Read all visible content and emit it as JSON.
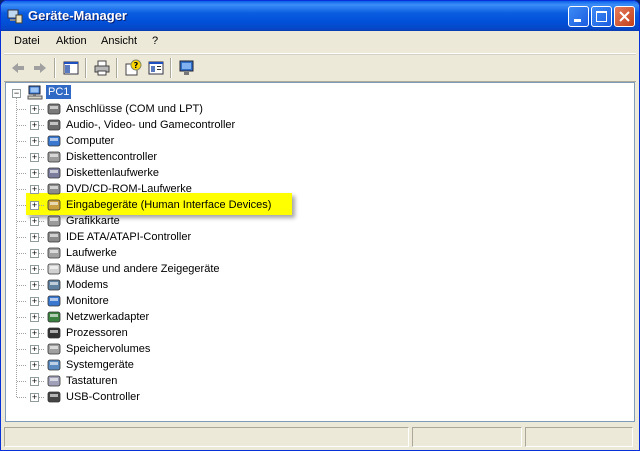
{
  "window": {
    "title": "Geräte-Manager",
    "title_color": "#0A5FEA"
  },
  "menu": {
    "items": [
      "Datei",
      "Aktion",
      "Ansicht",
      "?"
    ]
  },
  "toolbar": {
    "buttons": [
      "back-icon",
      "forward-icon",
      "show-hide-console-tree-icon",
      "print-icon",
      "properties-help-icon",
      "properties-icon",
      "scan-hardware-icon"
    ]
  },
  "tree": {
    "root": "PC1",
    "items": [
      {
        "label": "Anschlüsse (COM und LPT)",
        "icon": "port-icon"
      },
      {
        "label": "Audio-, Video- und Gamecontroller",
        "icon": "audio-icon"
      },
      {
        "label": "Computer",
        "icon": "computer-icon"
      },
      {
        "label": "Diskettencontroller",
        "icon": "floppy-controller-icon"
      },
      {
        "label": "Diskettenlaufwerke",
        "icon": "floppy-drive-icon"
      },
      {
        "label": "DVD/CD-ROM-Laufwerke",
        "icon": "cdrom-icon"
      },
      {
        "label": "Eingabegeräte (Human Interface Devices)",
        "icon": "hid-icon"
      },
      {
        "label": "Grafikkarte",
        "icon": "display-adapter-icon"
      },
      {
        "label": "IDE ATA/ATAPI-Controller",
        "icon": "ide-controller-icon"
      },
      {
        "label": "Laufwerke",
        "icon": "disk-drive-icon"
      },
      {
        "label": "Mäuse und andere Zeigegeräte",
        "icon": "mouse-icon"
      },
      {
        "label": "Modems",
        "icon": "modem-icon"
      },
      {
        "label": "Monitore",
        "icon": "monitor-icon"
      },
      {
        "label": "Netzwerkadapter",
        "icon": "network-adapter-icon"
      },
      {
        "label": "Prozessoren",
        "icon": "processor-icon"
      },
      {
        "label": "Speichervolumes",
        "icon": "storage-volume-icon"
      },
      {
        "label": "Systemgeräte",
        "icon": "system-device-icon"
      },
      {
        "label": "Tastaturen",
        "icon": "keyboard-icon"
      },
      {
        "label": "USB-Controller",
        "icon": "usb-icon"
      }
    ],
    "highlighted_index": 6,
    "highlight_color": "#FFFF00",
    "selection_color": "#316AC5"
  }
}
